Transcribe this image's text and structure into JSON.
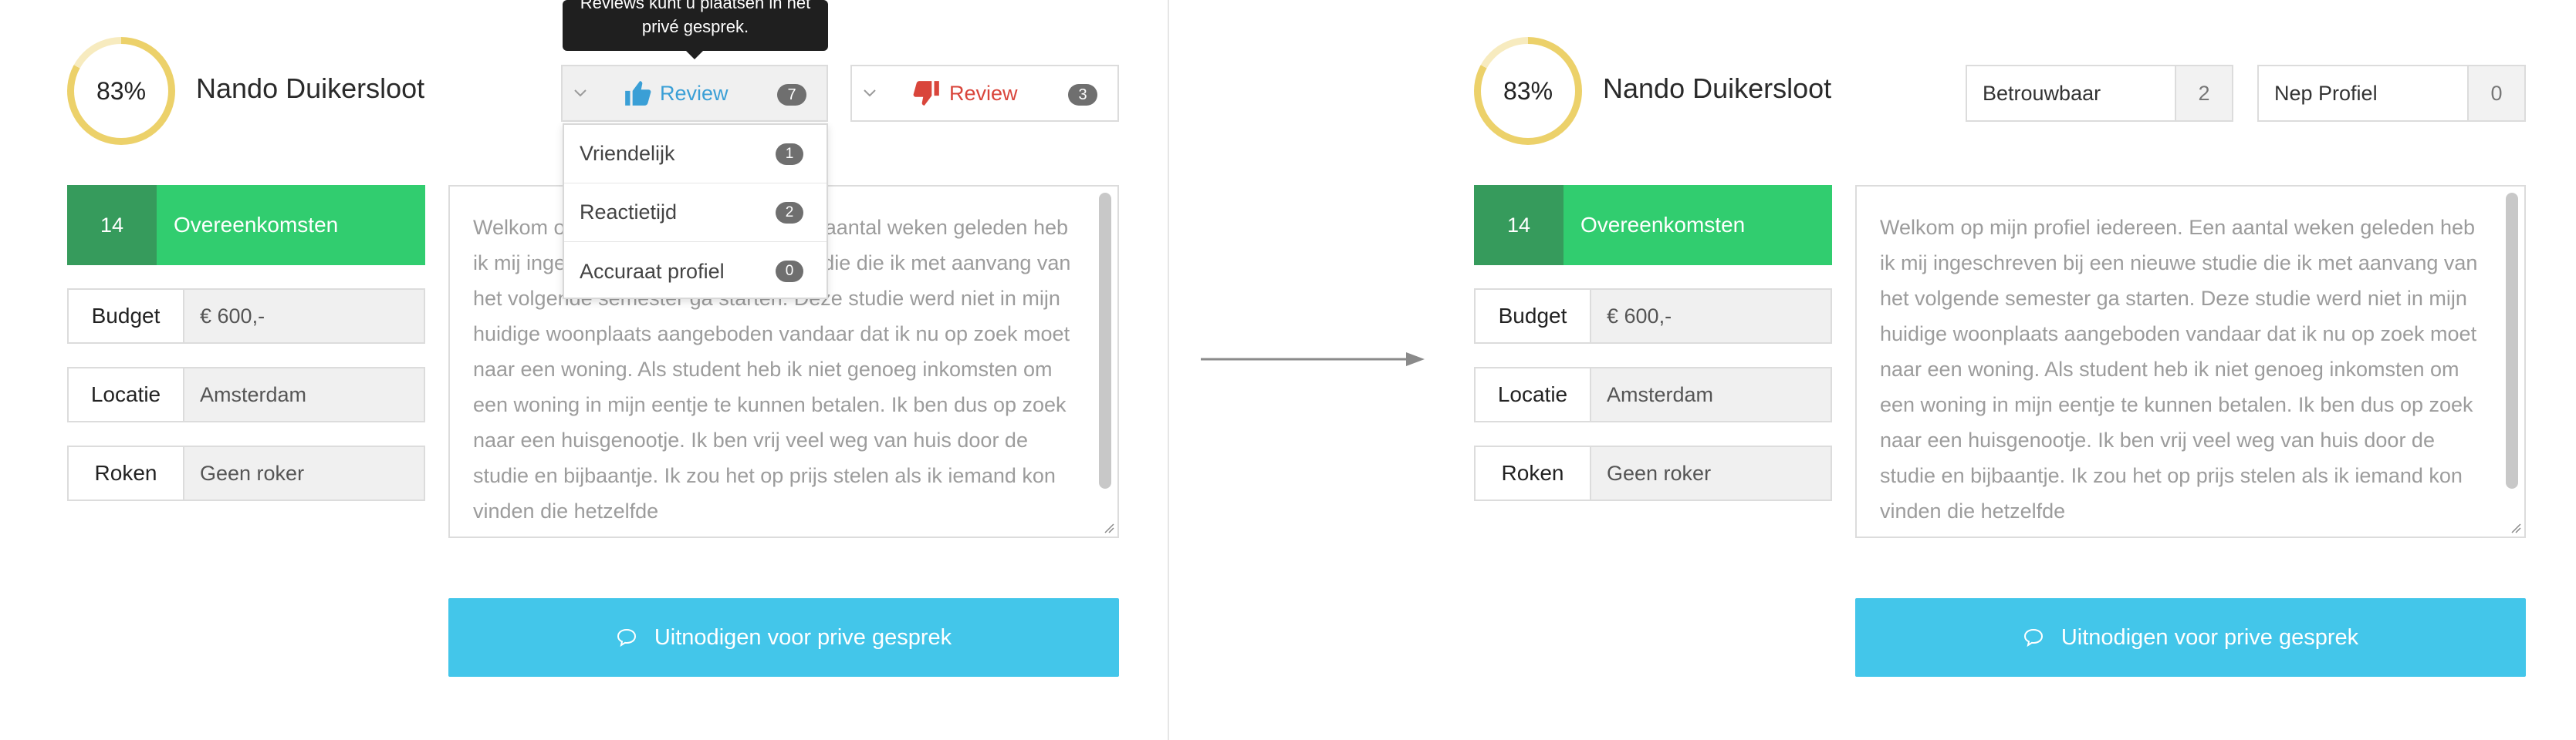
{
  "left": {
    "score": "83%",
    "name": "Nando Duikersloot",
    "tooltip": "Reviews kunt u plaatsen in het privé gesprek.",
    "review_up": {
      "label": "Review",
      "count": "7",
      "icon": "thumbs-up-icon"
    },
    "review_down": {
      "label": "Review",
      "count": "3",
      "icon": "thumbs-down-icon"
    },
    "dropdown": [
      {
        "label": "Vriendelijk",
        "count": "1"
      },
      {
        "label": "Reactietijd",
        "count": "2"
      },
      {
        "label": "Accuraat profiel",
        "count": "0"
      }
    ],
    "agreements": {
      "count": "14",
      "label": "Overeenkomsten"
    },
    "fields": [
      {
        "label": "Budget",
        "value": "€ 600,-"
      },
      {
        "label": "Locatie",
        "value": "Amsterdam"
      },
      {
        "label": "Roken",
        "value": "Geen roker"
      }
    ],
    "bio": "Welkom op mijn profiel iedereen. Een aantal weken geleden heb ik mij ingeschreven bij een nieuwe studie die ik met aanvang van het volgende semester ga starten. Deze studie werd niet in mijn huidige woonplaats aangeboden vandaar dat ik nu op zoek moet naar een woning. Als student heb ik niet genoeg inkomsten om een woning in mijn eentje te kunnen betalen. Ik ben dus op zoek naar een huisgenootje. Ik ben vrij veel weg van huis door de studie en bijbaantje. Ik zou het op prijs stelen als ik iemand kon vinden die hetzelfde",
    "invite_label": "Uitnodigen voor prive gesprek"
  },
  "right": {
    "score": "83%",
    "name": "Nando Duikersloot",
    "trust": [
      {
        "label": "Betrouwbaar",
        "count": "2"
      },
      {
        "label": "Nep Profiel",
        "count": "0"
      }
    ],
    "agreements": {
      "count": "14",
      "label": "Overeenkomsten"
    },
    "fields": [
      {
        "label": "Budget",
        "value": "€ 600,-"
      },
      {
        "label": "Locatie",
        "value": "Amsterdam"
      },
      {
        "label": "Roken",
        "value": "Geen roker"
      }
    ],
    "bio": "Welkom op mijn profiel iedereen. Een aantal weken geleden heb ik mij ingeschreven bij een nieuwe studie die ik met aanvang van het volgende semester ga starten. Deze studie werd niet in mijn huidige woonplaats aangeboden vandaar dat ik nu op zoek moet naar een woning. Als student heb ik niet genoeg inkomsten om een woning in mijn eentje te kunnen betalen. Ik ben dus op zoek naar een huisgenootje. Ik ben vrij veel weg van huis door de studie en bijbaantje. Ik zou het op prijs stelen als ik iemand kon vinden die hetzelfde",
    "invite_label": "Uitnodigen voor prive gesprek"
  },
  "colors": {
    "ring": "#ecd16a",
    "agree_dark": "#369b5c",
    "agree_light": "#31cd6f",
    "invite": "#43c6ea",
    "thumbs_up": "#3a9fd6",
    "thumbs_down": "#d9453b"
  },
  "icons": {
    "transition": "arrow-right-icon",
    "chat": "chat-bubble-icon",
    "chevron": "chevron-down-icon"
  }
}
